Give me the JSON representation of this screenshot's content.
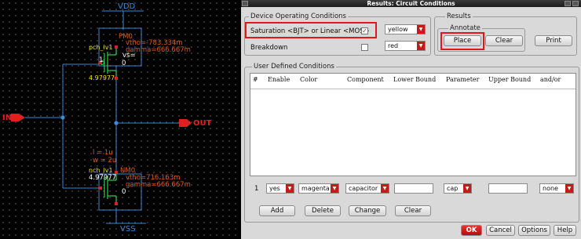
{
  "schematic": {
    "pins": {
      "vdd": "VDD",
      "vss": "VSS",
      "in": "IN",
      "out": "OUT"
    },
    "pmos": {
      "model": "pch_lv1",
      "name": "PM0",
      "width": "4.97977",
      "m": "1",
      "vtho": "vtho=-783.334m",
      "gamma": "gamma=666.667m",
      "vs": "vs="
    },
    "nmos": {
      "model": "nch_lv1",
      "name": "NM0",
      "width": "4.97977",
      "l": "l = 1u",
      "w": "w = 2u",
      "vtho": "vtho=716.163m",
      "gamma": "gamma=666.667m"
    },
    "source_marks": [
      "0",
      "0"
    ]
  },
  "dialog": {
    "title": "Results: Circuit Conditions",
    "device_group": "Device Operating Conditions",
    "conditions": [
      {
        "label": "Saturation <BJT> or Linear <MOS>",
        "checked": true,
        "color": "yellow",
        "highlighted": true
      },
      {
        "label": "Breakdown",
        "checked": false,
        "color": "red",
        "highlighted": false
      }
    ],
    "results_group": "Results",
    "annotate_group": "Annotate",
    "place_button": "Place",
    "clear_button": "Clear",
    "print_button": "Print",
    "user_group": "User Defined Conditions",
    "columns": [
      "#",
      "Enable",
      "Color",
      "Component",
      "Lower Bound",
      "Parameter",
      "Upper Bound",
      "and/or"
    ],
    "edit_row": {
      "index": "1",
      "enable": "yes",
      "color": "magenta",
      "component": "capacitor",
      "lower": "",
      "parameter": "cap",
      "upper": "",
      "andor": "none"
    },
    "action_buttons": {
      "add": "Add",
      "delete": "Delete",
      "change": "Change",
      "clear": "Clear"
    },
    "footer": {
      "ok": "OK",
      "cancel": "Cancel",
      "options": "Options",
      "help": "Help"
    },
    "colors": {
      "highlight": "#e01818",
      "accent": "#c81818"
    }
  }
}
